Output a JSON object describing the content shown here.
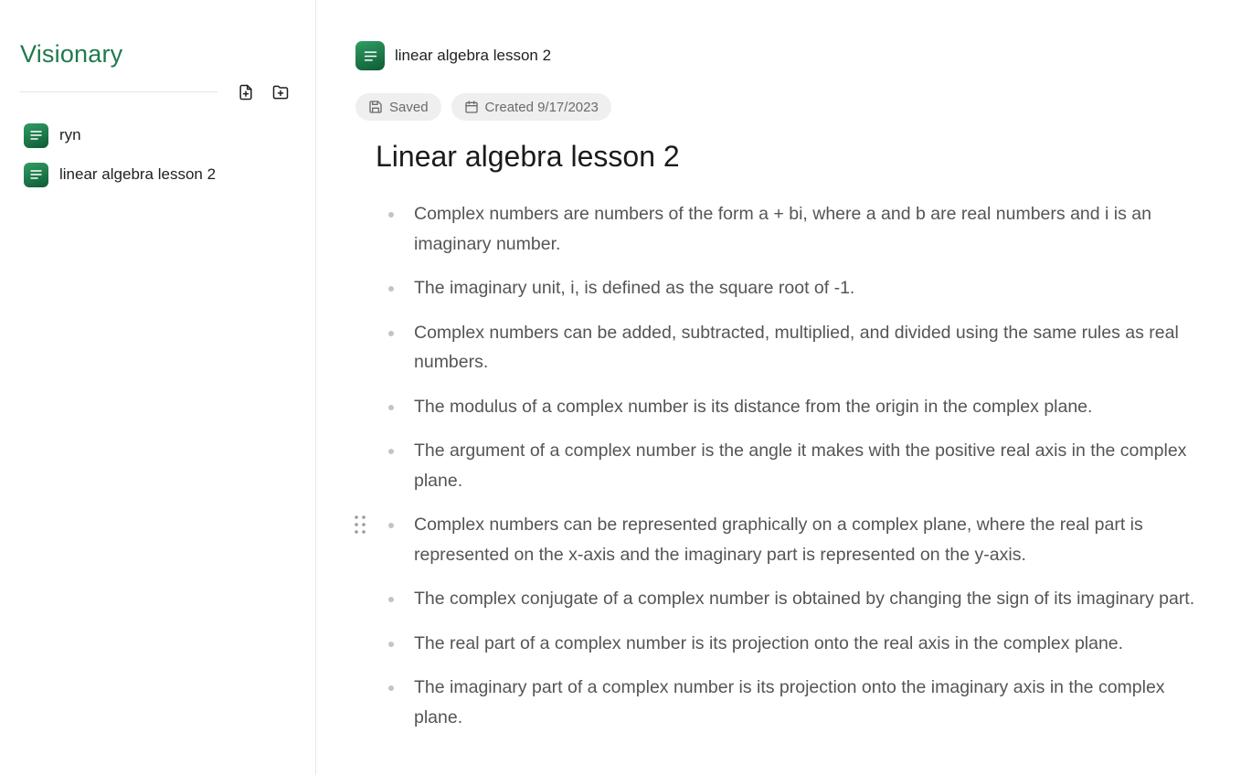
{
  "sidebar": {
    "brand": "Visionary",
    "actions": [
      {
        "icon": "new-file-icon"
      },
      {
        "icon": "new-folder-icon"
      }
    ],
    "items": [
      {
        "label": "ryn",
        "icon": "document-icon"
      },
      {
        "label": "linear algebra lesson 2",
        "icon": "document-icon"
      }
    ]
  },
  "document": {
    "header_title": "linear algebra lesson 2",
    "status": {
      "saved_label": "Saved",
      "created_label": "Created 9/17/2023"
    },
    "title": "Linear algebra lesson 2",
    "bullets": [
      "Complex numbers are numbers of the form a + bi, where a and b are real numbers and i is an imaginary number.",
      "The imaginary unit, i, is defined as the square root of -1.",
      "Complex numbers can be added, subtracted, multiplied, and divided using the same rules as real numbers.",
      "The modulus of a complex number is its distance from the origin in the complex plane.",
      "The argument of a complex number is the angle it makes with the positive real axis in the complex plane.",
      "Complex numbers can be represented graphically on a complex plane, where the real part is represented on the x-axis and the imaginary part is represented on the y-axis.",
      "The complex conjugate of a complex number is obtained by changing the sign of its imaginary part.",
      "The real part of a complex number is its projection onto the real axis in the complex plane.",
      "The imaginary part of a complex number is its projection onto the imaginary axis in the complex plane."
    ]
  },
  "colors": {
    "brand": "#1f7a4c",
    "badge_top": "#2f9e63",
    "badge_bottom": "#0f5a35",
    "chip_bg": "#efefef",
    "bullet_text": "#555555"
  }
}
